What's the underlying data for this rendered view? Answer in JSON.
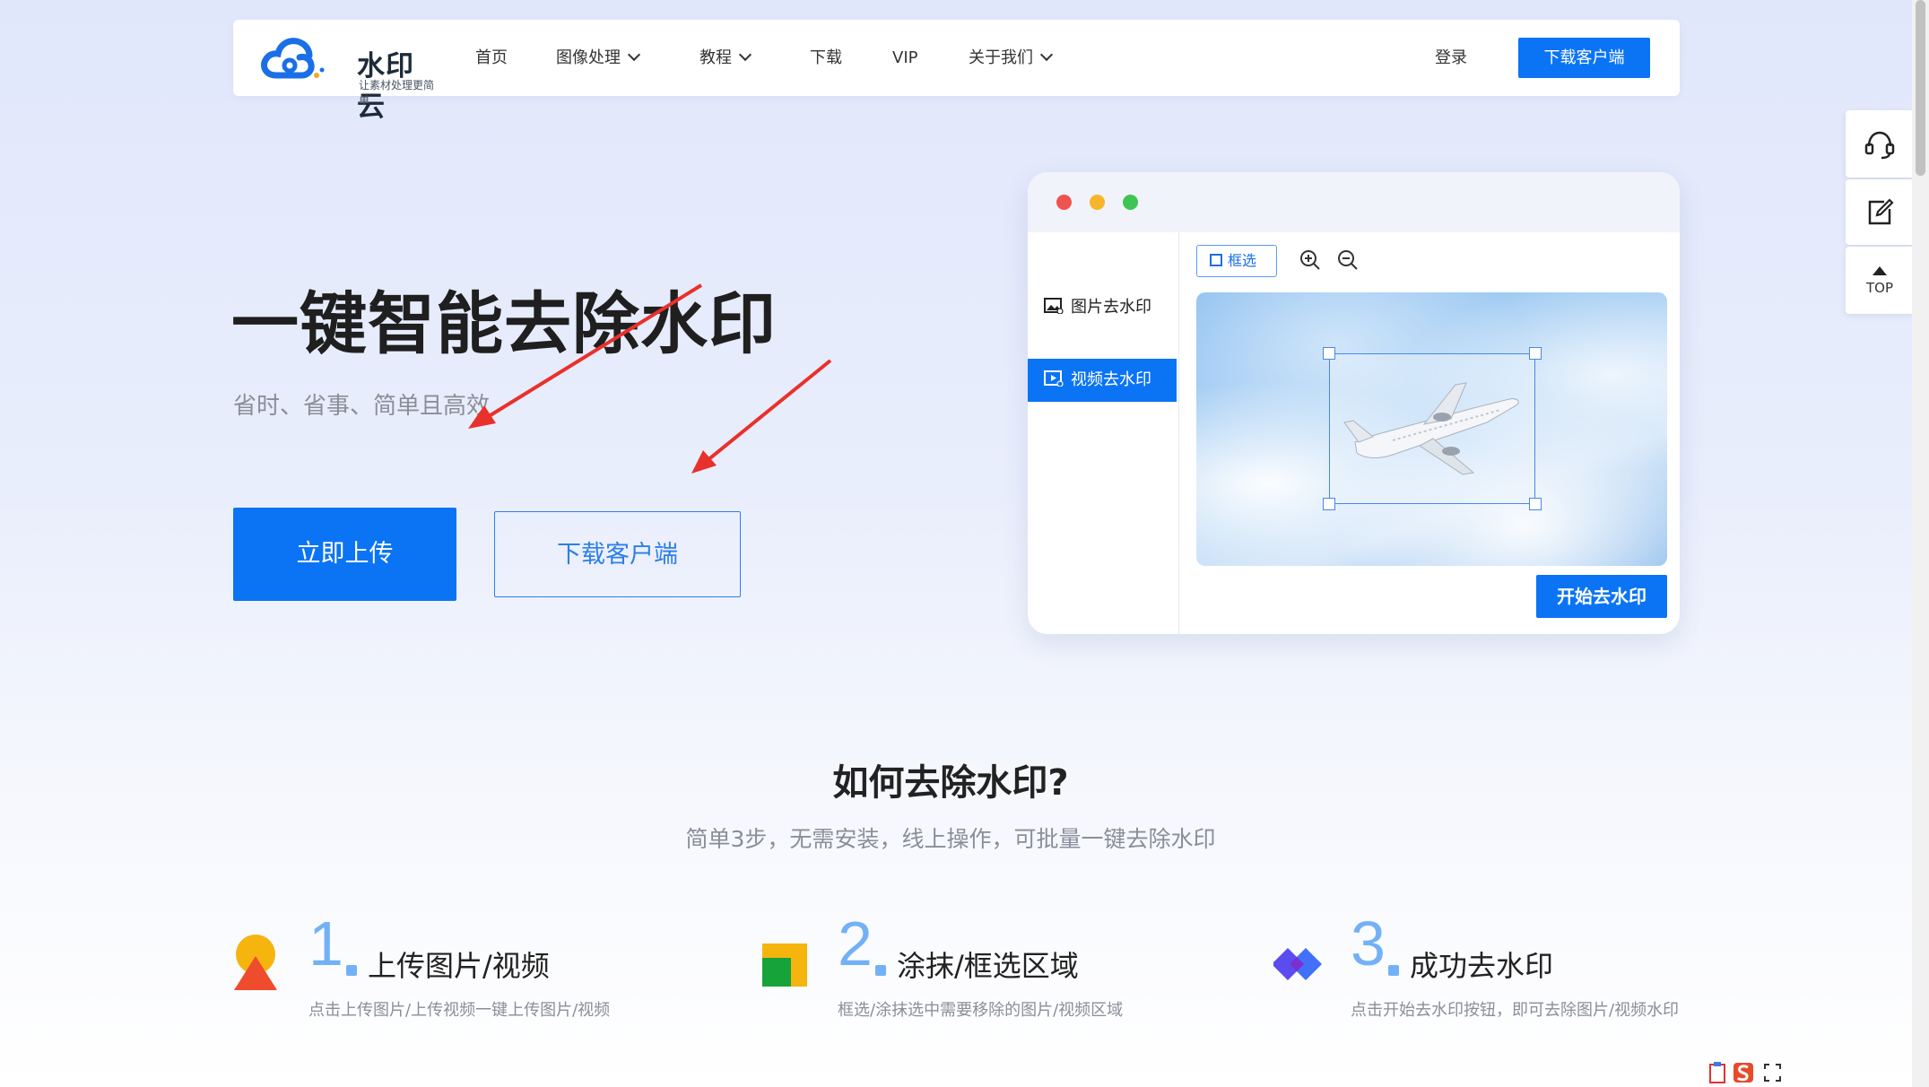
{
  "nav": {
    "logo_text": "水印云",
    "logo_tagline": "让素材处理更简单",
    "items": [
      {
        "label": "首页",
        "dropdown": false
      },
      {
        "label": "图像处理",
        "dropdown": true
      },
      {
        "label": "教程",
        "dropdown": true
      },
      {
        "label": "下载",
        "dropdown": false
      },
      {
        "label": "VIP",
        "dropdown": false
      },
      {
        "label": "关于我们",
        "dropdown": true
      }
    ],
    "login": "登录",
    "download_client": "下载客户端"
  },
  "hero": {
    "title": "一键智能去除水印",
    "subtitle": "省时、省事、简单且高效",
    "upload_button": "立即上传",
    "download_button": "下载客户端"
  },
  "demo": {
    "sidebar": [
      {
        "label": "图片去水印",
        "active": false
      },
      {
        "label": "视频去水印",
        "active": true
      }
    ],
    "tool_select": "框选",
    "start_button": "开始去水印"
  },
  "steps_section": {
    "title": "如何去除水印?",
    "subtitle": "简单3步，无需安装，线上操作，可批量一键去除水印",
    "steps": [
      {
        "number": "1",
        "title": "上传图片/视频",
        "desc": "点击上传图片/上传视频一键上传图片/视频"
      },
      {
        "number": "2",
        "title": "涂抹/框选区域",
        "desc": "框选/涂抹选中需要移除的图片/视频区域"
      },
      {
        "number": "3",
        "title": "成功去水印",
        "desc": "点击开始去水印按钮，即可去除图片/视频水印"
      }
    ]
  },
  "float_bar": {
    "top_label": "TOP"
  },
  "colors": {
    "primary": "#0a74f5",
    "step_number": "#73b1f7",
    "annotation_arrow": "#e8312b"
  }
}
